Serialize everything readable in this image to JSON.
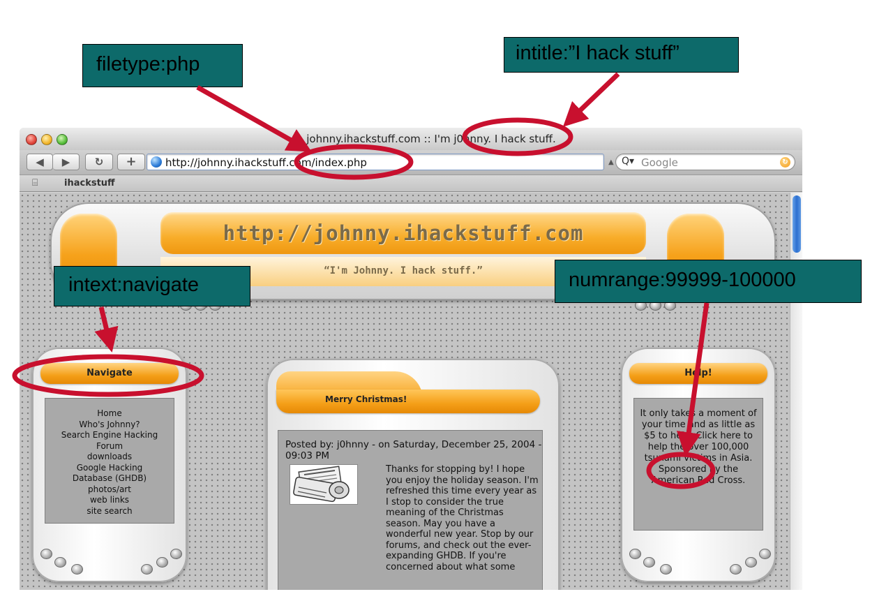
{
  "annotations": {
    "filetype": "filetype:php",
    "intitle": "intitle:”I hack stuff”",
    "intext": "intext:navigate",
    "numrange": "numrange:99999-100000",
    "color": "#0d6a6a",
    "marker_color": "#c8102e"
  },
  "browser": {
    "window_title": "johnny.ihackstuff.com :: I'm j0hnny. I hack stuff.",
    "back_icon": "◀",
    "forward_icon": "▶",
    "reload_icon": "↻",
    "add_icon": "+",
    "url": "http://johnny.ihackstuff.com/index.php",
    "search_placeholder": "Google",
    "search_icon": "Q▾",
    "bookmark_icon": "⌸",
    "bookmark": "ihackstuff"
  },
  "site": {
    "url_title": "http://johnny.ihackstuff.com",
    "tagline": "“I'm Johnny. I hack stuff.”"
  },
  "navigate": {
    "title": "Navigate",
    "links": [
      "Home",
      "Who's Johnny?",
      "Search Engine Hacking",
      "Forum",
      "downloads",
      "Google Hacking",
      "Database (GHDB)",
      "photos/art",
      "web links",
      "site search"
    ]
  },
  "help": {
    "title": "Help!",
    "text": "It only takes a moment of your time and as little as $5 to help. Click here to help the over 100,000 tsunami victims in Asia. Sponsored by the American Red Cross."
  },
  "post": {
    "title": "Merry Christmas!",
    "meta": "Posted by: j0hnny - on Saturday, December 25, 2004 - 09:03 PM",
    "image_label": "newspaper-image",
    "body": "Thanks for stopping by! I hope you enjoy the holiday season. I'm refreshed this time every year as I stop to consider the true meaning of the Christmas season. May you have a wonderful new year. Stop by our forums, and check out the ever-expanding GHDB. If you're concerned about what some"
  }
}
